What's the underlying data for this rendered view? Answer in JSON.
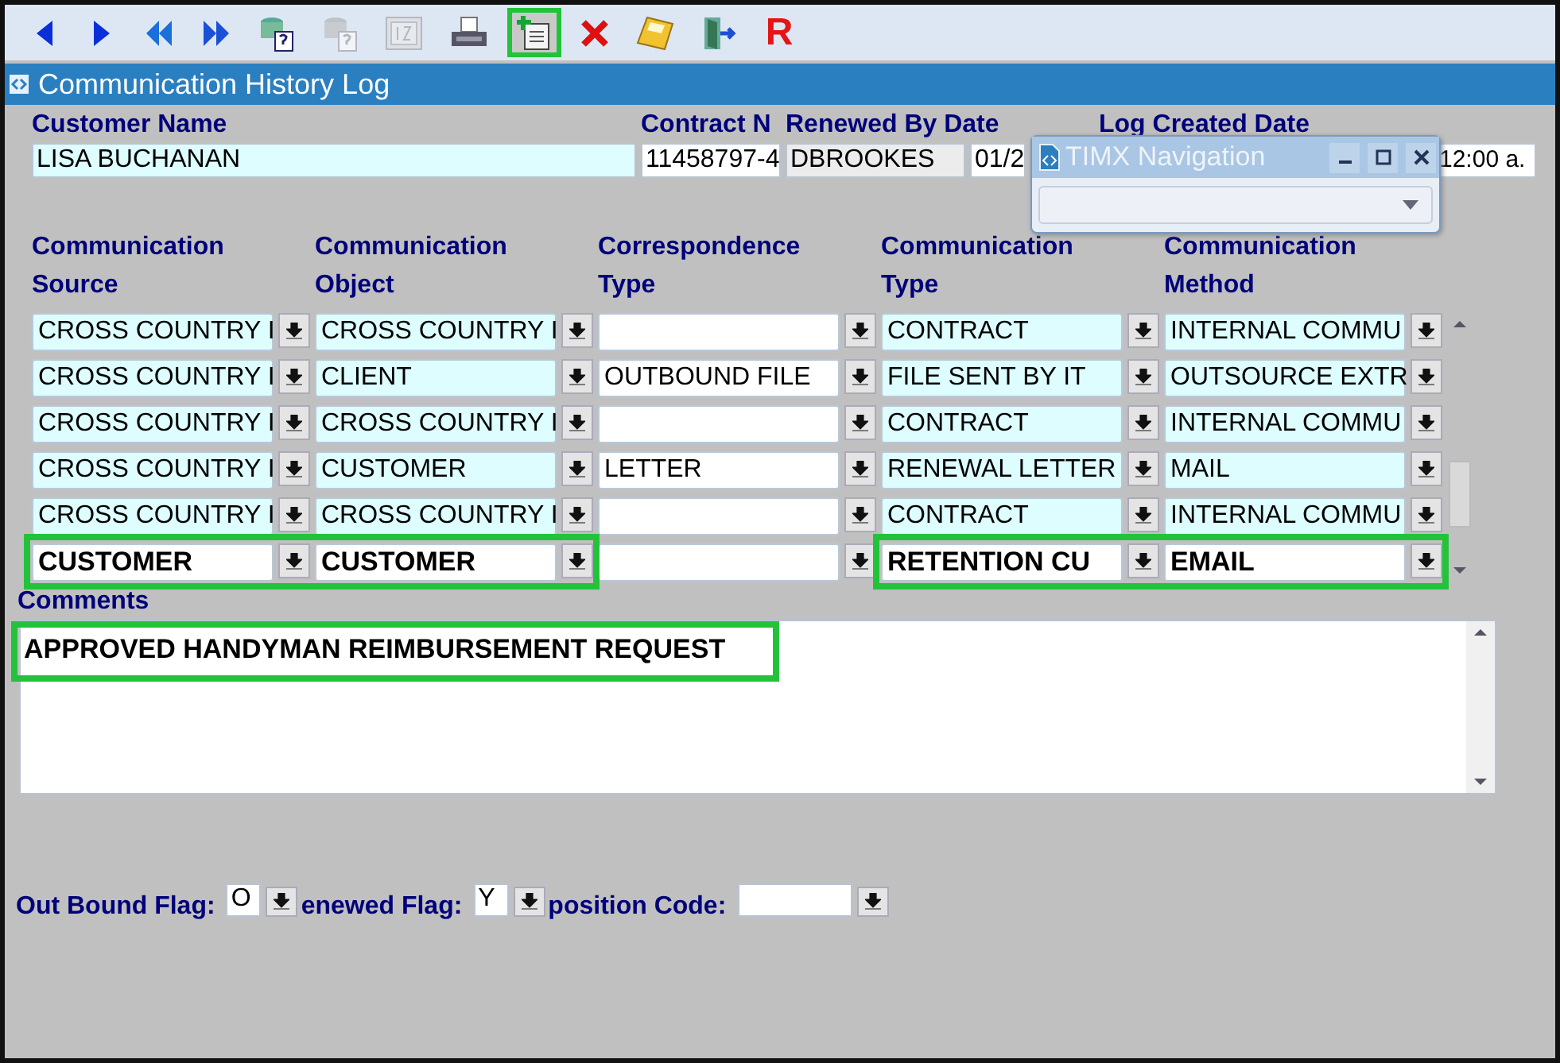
{
  "toolbar": [
    {
      "kind": "prev",
      "disabled": false,
      "highlighted": false
    },
    {
      "kind": "next",
      "disabled": false,
      "highlighted": false
    },
    {
      "kind": "first",
      "disabled": false,
      "highlighted": false
    },
    {
      "kind": "last",
      "disabled": false,
      "highlighted": false
    },
    {
      "kind": "query",
      "disabled": false,
      "highlighted": false
    },
    {
      "kind": "query-cancel",
      "disabled": true,
      "highlighted": false
    },
    {
      "kind": "count",
      "disabled": true,
      "highlighted": false
    },
    {
      "kind": "print",
      "disabled": false,
      "highlighted": false
    },
    {
      "kind": "insert",
      "disabled": false,
      "highlighted": true
    },
    {
      "kind": "delete",
      "disabled": false,
      "highlighted": false
    },
    {
      "kind": "save",
      "disabled": false,
      "highlighted": false
    },
    {
      "kind": "exit",
      "disabled": false,
      "highlighted": false
    },
    {
      "kind": "text",
      "label": "R",
      "disabled": false,
      "highlighted": false
    }
  ],
  "form": {
    "title": "Communication History Log"
  },
  "header_labels": [
    "Customer Name",
    "Contract N",
    "Renewed By Date",
    "Log Created Date"
  ],
  "header_values": [
    {
      "value": "LISA BUCHANAN",
      "kind": "lookup"
    },
    {
      "value": "11458797-4",
      "kind": "text"
    },
    {
      "value": "DBROOKES",
      "kind": "readonly"
    },
    {
      "value": "01/2",
      "kind": "text"
    },
    {
      "value": "12:00 a.",
      "kind": "text"
    }
  ],
  "columns": [
    {
      "label": "Communication Source",
      "kind": "lookup"
    },
    {
      "label": "Communication Object",
      "kind": "lookup"
    },
    {
      "label": "Correspondence Type",
      "kind": "text"
    },
    {
      "label": "Communication Type",
      "kind": "lookup"
    },
    {
      "label": "Communication Method",
      "kind": "lookup"
    }
  ],
  "rows": [
    {
      "current": false,
      "cells": [
        {
          "value": "CROSS COUNTRY I",
          "highlighted": false
        },
        {
          "value": "CROSS COUNTRY I",
          "highlighted": false
        },
        {
          "highlighted": false
        },
        {
          "value": "CONTRACT",
          "highlighted": false
        },
        {
          "value": "INTERNAL COMMU",
          "highlighted": false
        }
      ]
    },
    {
      "current": false,
      "cells": [
        {
          "value": "CROSS COUNTRY I",
          "highlighted": false
        },
        {
          "value": "CLIENT",
          "highlighted": false
        },
        {
          "value": "OUTBOUND FILE",
          "highlighted": false
        },
        {
          "value": "FILE SENT BY IT",
          "highlighted": false
        },
        {
          "value": "OUTSOURCE EXTR",
          "highlighted": false
        }
      ]
    },
    {
      "current": false,
      "cells": [
        {
          "value": "CROSS COUNTRY I",
          "highlighted": false
        },
        {
          "value": "CROSS COUNTRY I",
          "highlighted": false
        },
        {
          "highlighted": false
        },
        {
          "value": "CONTRACT",
          "highlighted": false
        },
        {
          "value": "INTERNAL COMMU",
          "highlighted": false
        }
      ]
    },
    {
      "current": false,
      "cells": [
        {
          "value": "CROSS COUNTRY I",
          "highlighted": false
        },
        {
          "value": "CUSTOMER",
          "highlighted": false
        },
        {
          "value": "LETTER",
          "highlighted": false
        },
        {
          "value": "RENEWAL LETTER",
          "highlighted": false
        },
        {
          "value": "MAIL",
          "highlighted": false
        }
      ]
    },
    {
      "current": false,
      "cells": [
        {
          "value": "CROSS COUNTRY I",
          "highlighted": false
        },
        {
          "value": "CROSS COUNTRY I",
          "highlighted": false
        },
        {
          "highlighted": false
        },
        {
          "value": "CONTRACT",
          "highlighted": false
        },
        {
          "value": "INTERNAL COMMU",
          "highlighted": false
        }
      ]
    },
    {
      "current": true,
      "cells": [
        {
          "value": "CUSTOMER",
          "highlighted": true
        },
        {
          "value": "CUSTOMER",
          "highlighted": true
        },
        {
          "highlighted": false
        },
        {
          "value": "RETENTION CU",
          "highlighted": true
        },
        {
          "value": "EMAIL",
          "highlighted": true
        }
      ]
    }
  ],
  "comments": {
    "label": "Comments",
    "value": "APPROVED HANDYMAN REIMBURSEMENT REQUEST",
    "highlighted": true
  },
  "flags": [
    {
      "label": "Out Bound Flag:",
      "value": "O",
      "kind": "flag"
    },
    {
      "label": "enewed Flag:",
      "value": "Y",
      "kind": "flag"
    },
    {
      "label": "position Code:",
      "kind": "code"
    }
  ],
  "popup": {
    "title": "TIMX Navigation"
  }
}
